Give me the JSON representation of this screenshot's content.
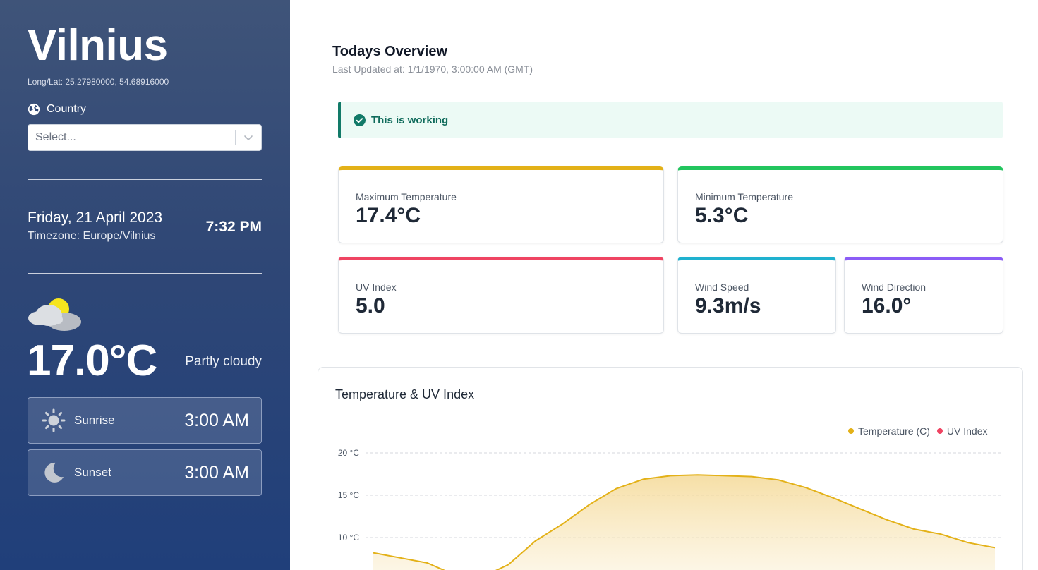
{
  "sidebar": {
    "city": "Vilnius",
    "coords": "Long/Lat: 25.27980000, 54.68916000",
    "country_label": "Country",
    "country_select": {
      "placeholder": "Select..."
    },
    "date": "Friday, 21 April 2023",
    "timezone": "Timezone: Europe/Vilnius",
    "time": "7:32 PM",
    "weather_icon": "partly-cloudy-icon",
    "temperature": "17.0°C",
    "condition": "Partly cloudy",
    "sunrise": {
      "label": "Sunrise",
      "value": "3:00 AM",
      "icon": "sun-icon"
    },
    "sunset": {
      "label": "Sunset",
      "value": "3:00 AM",
      "icon": "moon-icon"
    }
  },
  "main": {
    "title": "Todays Overview",
    "updated": "Last Updated at: 1/1/1970, 3:00:00 AM (GMT)",
    "alert": {
      "text": "This is working",
      "icon": "check-circle-icon"
    },
    "stats": {
      "max_temp": {
        "label": "Maximum Temperature",
        "value": "17.4°C",
        "color": "#e3b118"
      },
      "min_temp": {
        "label": "Minimum Temperature",
        "value": "5.3°C",
        "color": "#22c55e"
      },
      "uv": {
        "label": "UV Index",
        "value": "5.0",
        "color": "#ef4462"
      },
      "wind_speed": {
        "label": "Wind Speed",
        "value": "9.3m/s",
        "color": "#1fb1cf"
      },
      "wind_dir": {
        "label": "Wind Direction",
        "value": "16.0°",
        "color": "#8b5cf6"
      }
    },
    "chart_title": "Temperature & UV Index"
  },
  "chart_data": {
    "type": "area",
    "title": "Temperature & UV Index",
    "y_ticks": [
      "20 °C",
      "15 °C",
      "10 °C"
    ],
    "ylim": [
      0,
      20
    ],
    "grid": true,
    "legend_position": "top-right",
    "series": [
      {
        "name": "Temperature (C)",
        "color": "#e3b118",
        "values": [
          8.2,
          7.6,
          7.0,
          5.6,
          5.3,
          6.8,
          9.6,
          11.6,
          13.9,
          15.8,
          16.9,
          17.3,
          17.4,
          17.3,
          17.2,
          16.8,
          15.9,
          14.7,
          13.4,
          12.1,
          11.0,
          10.4,
          9.4,
          8.8
        ]
      },
      {
        "name": "UV Index",
        "color": "#ef4462",
        "values": []
      }
    ]
  }
}
